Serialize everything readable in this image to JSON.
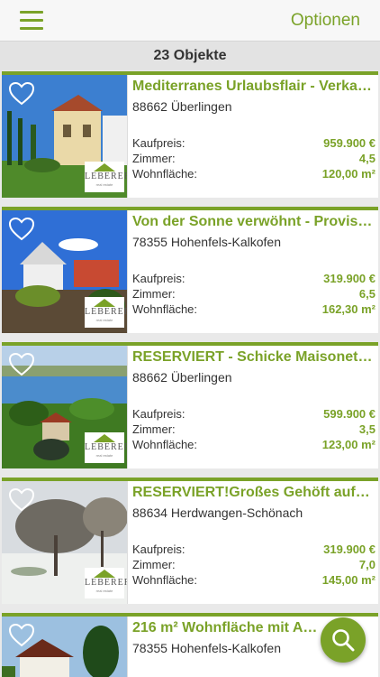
{
  "header": {
    "options_label": "Optionen"
  },
  "listing_count": "23 Objekte",
  "labels": {
    "price": "Kaufpreis:",
    "rooms": "Zimmer:",
    "area": "Wohnfläche:"
  },
  "logo": {
    "name": "LEBERER",
    "tagline": "real estate"
  },
  "listings": [
    {
      "title": "Mediterranes Urlaubsflair - Verka…",
      "location": "88662 Überlingen",
      "price": "959.900 €",
      "rooms": "4,5",
      "area": "120,00 m²"
    },
    {
      "title": "Von der Sonne verwöhnt - Provisi…",
      "location": "78355 Hohenfels-Kalkofen",
      "price": "319.900 €",
      "rooms": "6,5",
      "area": "162,30 m²"
    },
    {
      "title": "RESERVIERT - Schicke Maisonette…",
      "location": "88662 Überlingen",
      "price": "599.900 €",
      "rooms": "3,5",
      "area": "123,00 m²"
    },
    {
      "title": "RESERVIERT!Großes Gehöft auf gr…",
      "location": "88634 Herdwangen-Schönach",
      "price": "319.900 €",
      "rooms": "7,0",
      "area": "145,00 m²"
    },
    {
      "title": "216 m² Wohnfläche mit Ausb…",
      "location": "78355 Hohenfels-Kalkofen"
    }
  ],
  "colors": {
    "accent": "#7aa228"
  },
  "icons": {
    "menu": "hamburger-icon",
    "favorite": "heart-outline-icon",
    "search": "search-icon"
  }
}
